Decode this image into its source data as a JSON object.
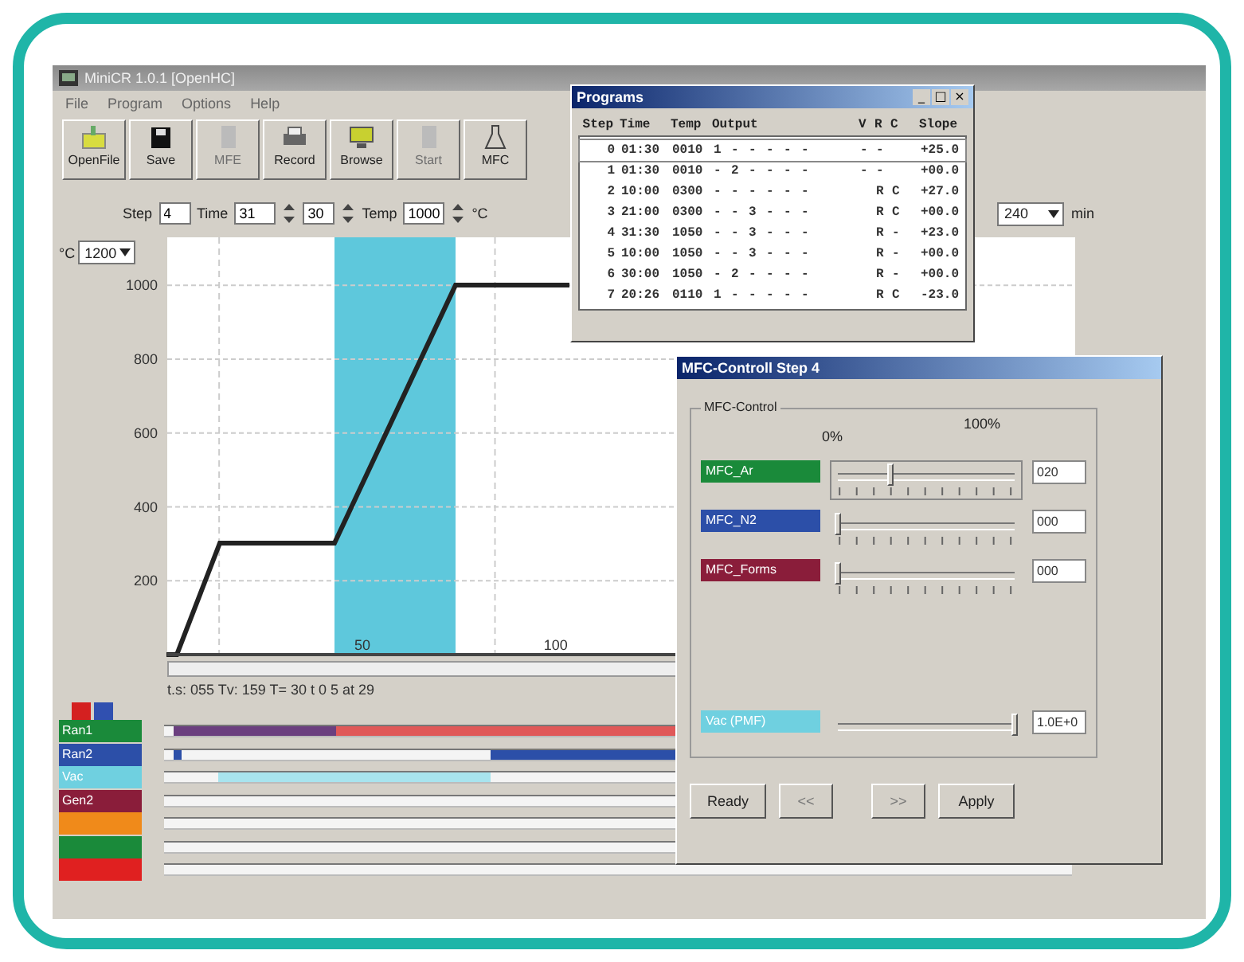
{
  "window": {
    "title": "MiniCR 1.0.1 [OpenHC]"
  },
  "menu": [
    "File",
    "Program",
    "Options",
    "Help"
  ],
  "toolbar": [
    {
      "label": "OpenFile",
      "kind": "folder",
      "disabled": false
    },
    {
      "label": "Save",
      "kind": "disk",
      "disabled": false
    },
    {
      "label": "MFE",
      "kind": "doc",
      "disabled": true
    },
    {
      "label": "Record",
      "kind": "printer",
      "disabled": false
    },
    {
      "label": "Browse",
      "kind": "monitor",
      "disabled": false
    },
    {
      "label": "Start",
      "kind": "doc",
      "disabled": true
    },
    {
      "label": "MFC",
      "kind": "flask",
      "disabled": false
    }
  ],
  "step_bar": {
    "step_label": "Step",
    "step": "4",
    "time_label": "Time",
    "minutes": "31",
    "seconds": "30",
    "temp_label": "Temp",
    "temp": "1000",
    "temp_unit": "°C"
  },
  "y_scale": {
    "unit": "°C",
    "value": "1200"
  },
  "x_scale": {
    "value": "240",
    "unit": "min"
  },
  "chart": {
    "chart_data": {
      "type": "line",
      "x": [
        0,
        2,
        13,
        43,
        74,
        103
      ],
      "series": [
        {
          "color": "#222222",
          "values": [
            0,
            0,
            300,
            300,
            1000,
            1000
          ]
        }
      ],
      "xlim": [
        0,
        233
      ],
      "ylim": [
        0,
        1130
      ],
      "yticks": [
        200,
        400,
        600,
        800,
        1000
      ],
      "xticks": [
        50,
        100
      ],
      "grid": true
    }
  },
  "status": "t.s: 055 Tv: 159 T= 30 t 0 5 at 29",
  "legend_keys": [
    {
      "color": "#d42020"
    },
    {
      "color": "#3050b0"
    }
  ],
  "tracks": [
    {
      "label": "Ran1",
      "color": "#1a8a3a",
      "segments": [
        {
          "color": "#6b3f7f"
        },
        {
          "color": "#e05858"
        }
      ]
    },
    {
      "label": "Ran2",
      "color": "#2c4fa8",
      "segments": [
        {
          "color": "#2c4fa8"
        },
        {
          "color": "#2c4fa8"
        }
      ]
    },
    {
      "label": "Vac",
      "color": "#6fd0e0",
      "segments": [
        {
          "color": "#a8e4ee"
        }
      ]
    },
    {
      "label": "Gen2",
      "color": "#8a1d3a"
    },
    {
      "color": "#f08a1a"
    },
    {
      "color": "#1a8a3a"
    },
    {
      "color": "#e02020"
    }
  ],
  "programs": {
    "title": "Programs",
    "window_buttons": [
      "_",
      "□",
      "×"
    ],
    "columns": [
      "Step",
      "Time",
      "Temp",
      "Output",
      "V",
      "R",
      "C",
      "Slope"
    ],
    "rows": [
      {
        "step": "0",
        "time": "01:30",
        "temp": "0010",
        "outputs": [
          "1",
          "-",
          "-",
          "-",
          "-",
          "-"
        ],
        "v": "-",
        "r": "-",
        "slope": "+25.0",
        "selected": true
      },
      {
        "step": "1",
        "time": "01:30",
        "temp": "0010",
        "outputs": [
          "-",
          "2",
          "-",
          "-",
          "-",
          "-"
        ],
        "v": "-",
        "r": "-",
        "slope": "+00.0",
        "selected": false
      },
      {
        "step": "2",
        "time": "10:00",
        "temp": "0300",
        "outputs": [
          "-",
          "-",
          "-",
          "-",
          "-",
          "-"
        ],
        "r": "R",
        "c": "C",
        "slope": "+27.0",
        "selected": false
      },
      {
        "step": "3",
        "time": "21:00",
        "temp": "0300",
        "outputs": [
          "-",
          "-",
          "3",
          "-",
          "-",
          "-"
        ],
        "r": "R",
        "c": "C",
        "slope": "+00.0",
        "selected": false
      },
      {
        "step": "4",
        "time": "31:30",
        "temp": "1050",
        "outputs": [
          "-",
          "-",
          "3",
          "-",
          "-",
          "-"
        ],
        "r": "R",
        "c": "-",
        "slope": "+23.0",
        "selected": false
      },
      {
        "step": "5",
        "time": "10:00",
        "temp": "1050",
        "outputs": [
          "-",
          "-",
          "3",
          "-",
          "-",
          "-"
        ],
        "r": "R",
        "c": "-",
        "slope": "+00.0",
        "selected": false
      },
      {
        "step": "6",
        "time": "30:00",
        "temp": "1050",
        "outputs": [
          "-",
          "2",
          "-",
          "-",
          "-",
          "-"
        ],
        "r": "R",
        "c": "-",
        "slope": "+00.0",
        "selected": false
      },
      {
        "step": "7",
        "time": "20:26",
        "temp": "0110",
        "outputs": [
          "1",
          "-",
          "-",
          "-",
          "-",
          "-"
        ],
        "r": "R",
        "c": "C",
        "slope": "-23.0",
        "selected": false
      }
    ]
  },
  "mfc_dialog": {
    "title": "MFC-Controll Step 4",
    "group": "MFC-Control",
    "min_label": "0%",
    "max_label": "100%",
    "channels": [
      {
        "name": "MFC_Ar",
        "color": "#1a8a3a",
        "level": 0.3,
        "value": "020",
        "focused": true,
        "kind": "ticked"
      },
      {
        "name": "MFC_N2",
        "color": "#2c4fa8",
        "level": 0,
        "value": "000",
        "focused": false,
        "kind": "ticked"
      },
      {
        "name": "MFC_Forms",
        "color": "#8a1d3a",
        "level": 0,
        "value": "000",
        "focused": false,
        "kind": "ticked"
      },
      {
        "name": "Vac (PMF)",
        "color": "#6fd0e0",
        "level": 1,
        "value": "1.0E+0",
        "focused": false,
        "kind": "plain"
      }
    ],
    "buttons": [
      {
        "label": "Ready",
        "disabled": false
      },
      {
        "label": "<<",
        "disabled": true
      },
      {
        "label": ">>",
        "disabled": true
      },
      {
        "label": "Apply",
        "disabled": false
      }
    ]
  }
}
